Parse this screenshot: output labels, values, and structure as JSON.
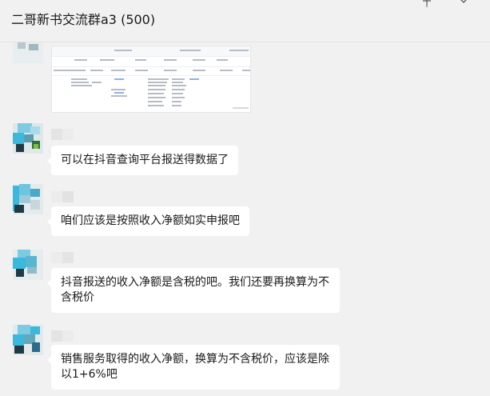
{
  "header": {
    "title": "二哥新书交流群a3 (500)",
    "pin_icon": "pin-icon",
    "more_icon": "chevron-down-icon"
  },
  "messages": [
    {
      "type": "image",
      "avatar": "blurred-avatar",
      "content": "screenshot-of-table"
    },
    {
      "type": "text",
      "avatar": "blurred-avatar",
      "text": "可以在抖音查询平台报送得数据了"
    },
    {
      "type": "text",
      "avatar": "blurred-avatar",
      "text": "咱们应该是按照收入净额如实申报吧"
    },
    {
      "type": "text",
      "avatar": "blurred-avatar",
      "text": "抖音报送的收入净额是含税的吧。我们还要再换算为不含税价"
    },
    {
      "type": "text",
      "avatar": "blurred-avatar",
      "text": "销售服务取得的收入净额，换算为不含税价，应该是除以1+6%吧"
    }
  ],
  "colors": {
    "background": "#f1f1f1",
    "bubble": "#ffffff",
    "text": "#191919",
    "avatar_cyan": "#3cb8dc",
    "avatar_dark": "#1f3a44"
  }
}
